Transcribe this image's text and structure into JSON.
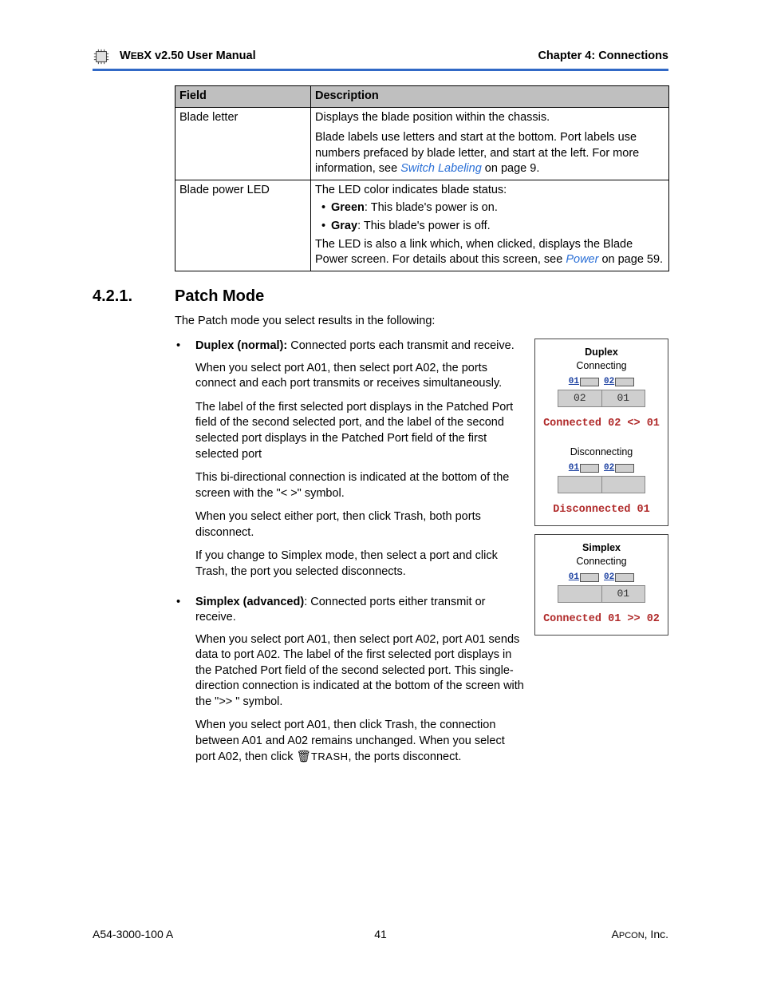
{
  "header": {
    "left_prefix": "W",
    "left_small": "EB",
    "left_rest": "X v2.50 User Manual",
    "right": "Chapter 4: Connections"
  },
  "table": {
    "head_field": "Field",
    "head_desc": "Description",
    "rows": [
      {
        "field": "Blade letter",
        "desc1": "Displays the blade position within the chassis.",
        "desc2_a": "Blade labels use letters and start at the bottom. Port labels use numbers prefaced by blade letter, and start at the left. For more information, see ",
        "desc2_link": "Switch Labeling",
        "desc2_b": " on page 9."
      },
      {
        "field": "Blade power LED",
        "intro": "The LED color indicates blade status:",
        "b1_label": "Green",
        "b1_text": ": This blade's power is on.",
        "b2_label": "Gray",
        "b2_text": ": This blade's power is off.",
        "tail_a": "The LED is also a link which, when clicked, displays the Blade Power screen. For details about this screen, see ",
        "tail_link": "Power",
        "tail_b": " on page 59."
      }
    ]
  },
  "section": {
    "num": "4.2.1.",
    "title": "Patch Mode",
    "intro": "The Patch mode you select results in the following:"
  },
  "duplex": {
    "label": "Duplex (normal):",
    "p1": " Connected ports each transmit and receive.",
    "p2": "When you select port A01, then select port A02, the ports connect and each port transmits or receives simultaneously.",
    "p3": "The label of the first selected port displays in the Patched Port field of the second selected port, and the label of the second selected port displays in the Patched Port field of the first selected port",
    "p4": "This bi-directional connection is indicated at the bottom of the screen with the \"< >\" symbol.",
    "p5": "When you select either port, then click Trash, both ports disconnect.",
    "p6": "If you change to Simplex mode, then select a port and click Trash, the port you selected disconnects."
  },
  "simplex": {
    "label": "Simplex (advanced)",
    "p1": ": Connected ports either transmit or receive.",
    "p2": "When you select port A01, then select port A02, port A01 sends data to port A02. The label of the first selected port displays in the Patched Port field of the second selected port. This single-direction connection is indicated at the bottom of the screen with the \">> \" symbol.",
    "p3a": "When you select port A01, then click Trash, the connection between A01 and A02 remains unchanged. When you select port A02, then click ",
    "p3_trash": "TRASH",
    "p3b": ", the ports disconnect."
  },
  "figs": {
    "duplex": {
      "title": "Duplex",
      "connecting": "Connecting",
      "p01": "01",
      "p02": "02",
      "slot1": "02",
      "slot2": "01",
      "status1": "Connected 02 <> 01",
      "disconnecting": "Disconnecting",
      "status2": "Disconnected 01"
    },
    "simplex": {
      "title": "Simplex",
      "connecting": "Connecting",
      "p01": "01",
      "p02": "02",
      "slot_right": "01",
      "status": "Connected 01 >> 02"
    }
  },
  "footer": {
    "left": "A54-3000-100 A",
    "center": "41",
    "right_a": "A",
    "right_small": "PCON",
    "right_b": ", Inc."
  }
}
